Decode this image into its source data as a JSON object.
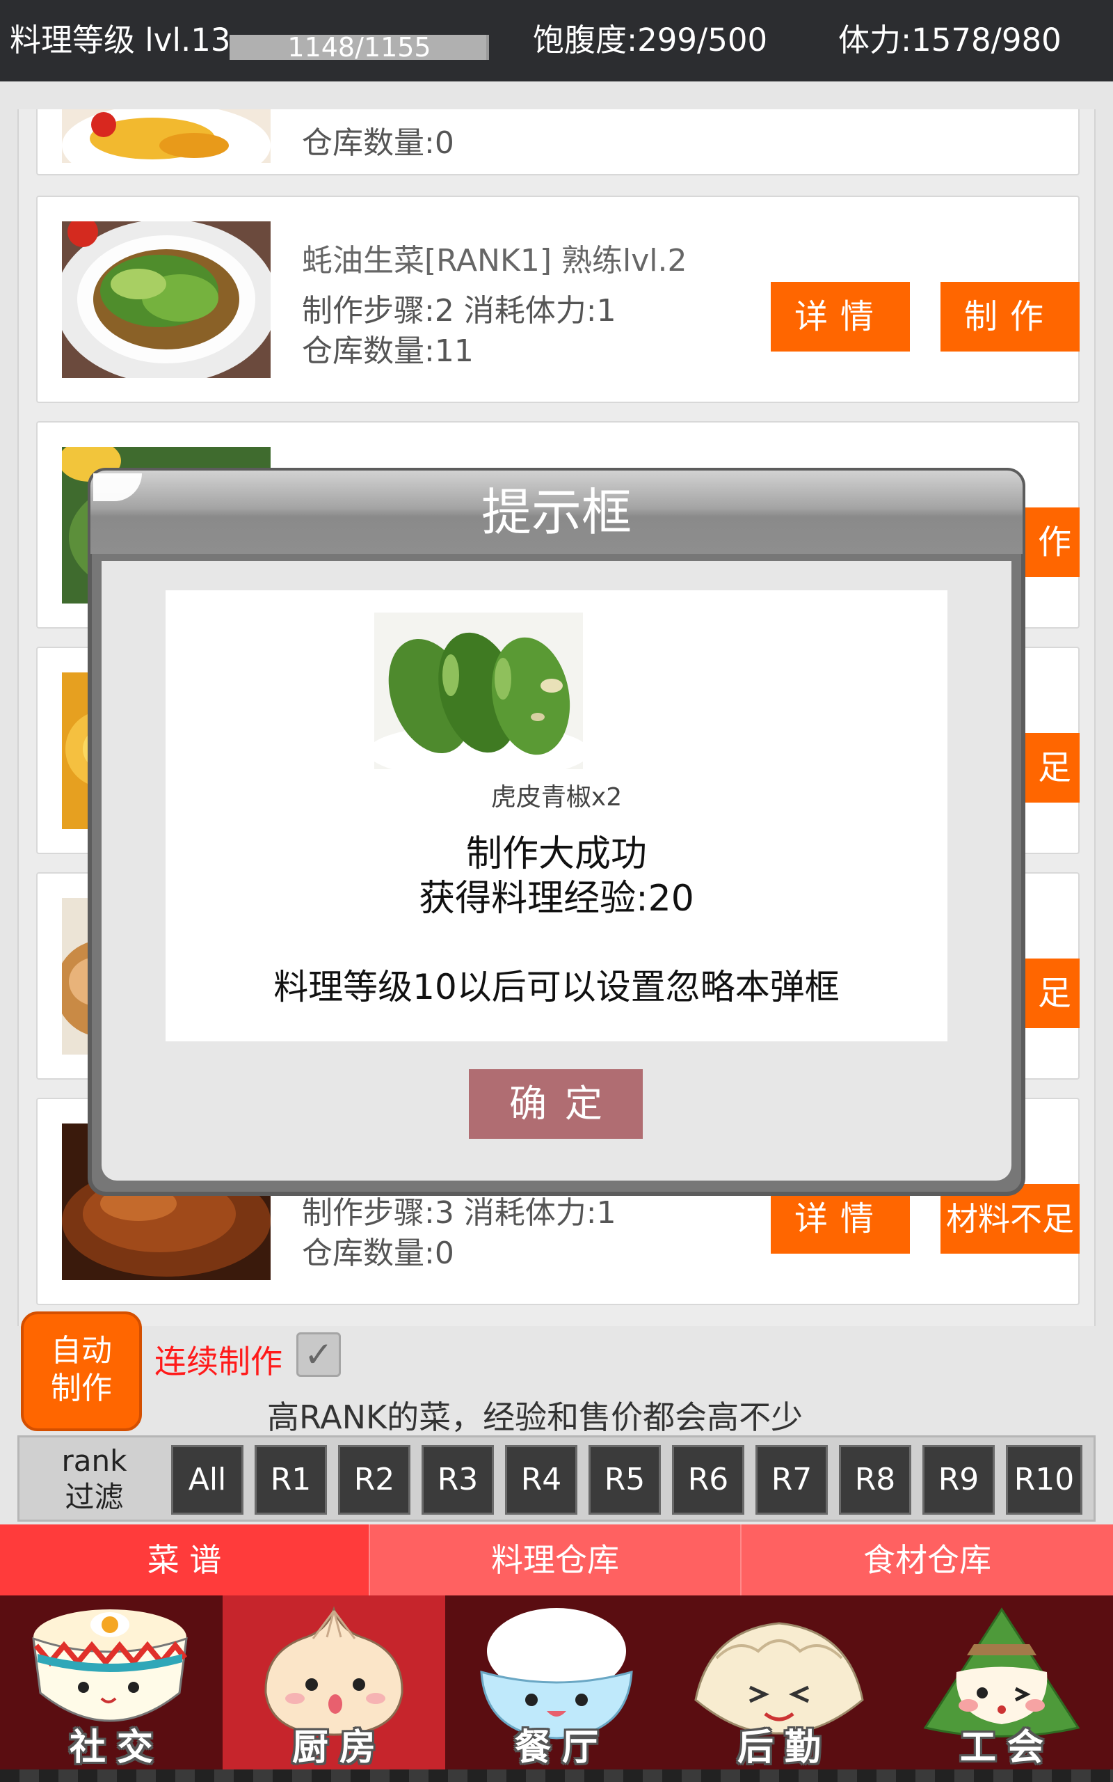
{
  "status": {
    "cooking_level": "料理等级 lvl.13",
    "xp_text": "1148/1155",
    "xp_fraction": 0.99,
    "satiety": "饱腹度:299/500",
    "stamina": "体力:1578/980"
  },
  "recipes": [
    {
      "title": "",
      "steps": "",
      "stock": "仓库数量:0",
      "detail_label": "",
      "make_label": ""
    },
    {
      "title": "蚝油生菜[RANK1]  熟练lvl.2",
      "steps": "制作步骤:2  消耗体力:1",
      "stock": "仓库数量:11",
      "detail_label": "详情",
      "make_label": "制作"
    },
    {
      "title": "",
      "steps": "",
      "stock": "",
      "detail_label": "",
      "make_label": "作"
    },
    {
      "title": "",
      "steps": "",
      "stock": "",
      "detail_label": "",
      "make_label": "足"
    },
    {
      "title": "",
      "steps": "",
      "stock": "",
      "detail_label": "",
      "make_label": "足"
    },
    {
      "title": "",
      "steps": "制作步骤:3  消耗体力:1",
      "stock": "仓库数量:0",
      "detail_label": "详情",
      "make_label": "材料不足"
    }
  ],
  "dialog": {
    "title": "提示框",
    "item_name": "虎皮青椒x2",
    "result": "制作大成功",
    "exp": "获得料理经验:20",
    "note": "料理等级10以后可以设置忽略本弹框",
    "ok_label": "确定"
  },
  "auto_make": {
    "button_line1": "自动",
    "button_line2": "制作",
    "continuous_label": "连续制作",
    "continuous_checked": true,
    "checkmark": "✓",
    "hint": "高RANK的菜，经验和售价都会高不少"
  },
  "rank_filter": {
    "label_line1": "rank",
    "label_line2": "过滤",
    "options": [
      "All",
      "R1",
      "R2",
      "R3",
      "R4",
      "R5",
      "R6",
      "R7",
      "R8",
      "R9",
      "R10"
    ]
  },
  "sub_tabs": {
    "active": "菜谱",
    "items": [
      "菜 谱",
      "料理仓库",
      "食材仓库"
    ]
  },
  "bottom_nav": {
    "active": "厨房",
    "items": [
      "社交",
      "厨房",
      "餐厅",
      "后勤",
      "工会"
    ],
    "icons": [
      "noodle-bowl-icon",
      "steamed-bun-icon",
      "rice-bowl-icon",
      "dumpling-icon",
      "zongzi-icon"
    ]
  },
  "colors": {
    "accent_orange": "#ff6600",
    "confirm_button": "#b06d72",
    "tab_active": "#ff3b3b",
    "nav_active": "#c6252c",
    "warning_red": "#ff1a1a"
  }
}
